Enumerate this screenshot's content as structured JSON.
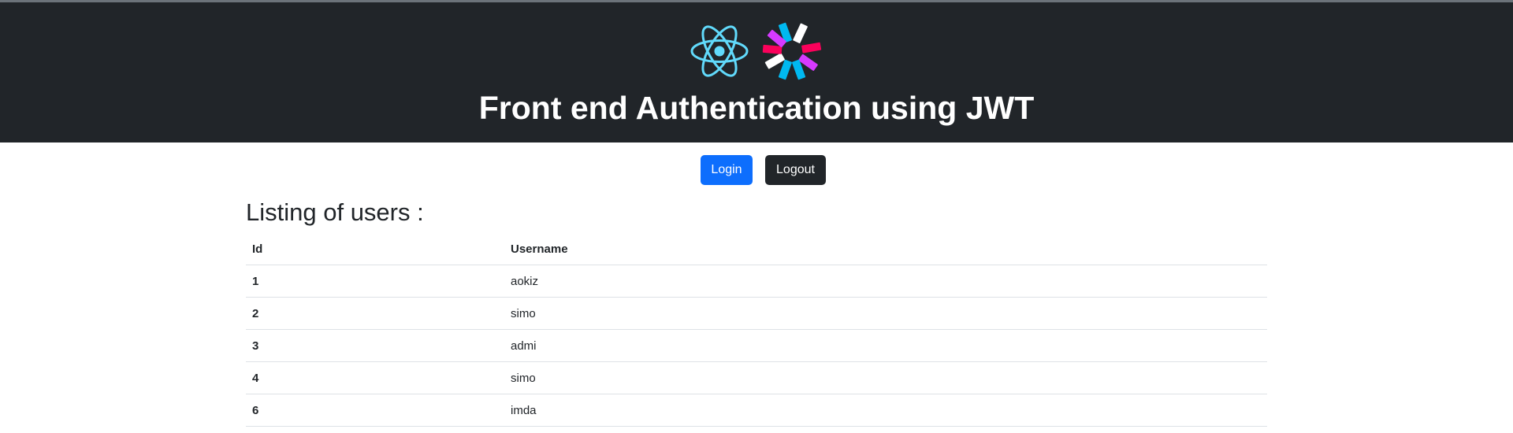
{
  "header": {
    "title": "Front end Authentication using JWT",
    "logos": [
      {
        "icon": "react-logo-icon",
        "color": "#61dafb"
      },
      {
        "icon": "jwt-logo-icon",
        "colors": [
          "#00b9f1",
          "#d63aff",
          "#fb015b",
          "#ffffff"
        ]
      }
    ],
    "background": "#212529"
  },
  "actions": {
    "login_label": "Login",
    "logout_label": "Logout",
    "login_color": "#0d6efd",
    "logout_color": "#212529"
  },
  "main": {
    "section_title": "Listing of users :",
    "table": {
      "columns": [
        "Id",
        "Username"
      ],
      "rows": [
        {
          "id": "1",
          "username": "aokiz"
        },
        {
          "id": "2",
          "username": "simo"
        },
        {
          "id": "3",
          "username": "admi"
        },
        {
          "id": "4",
          "username": "simo"
        },
        {
          "id": "6",
          "username": "imda"
        }
      ]
    }
  }
}
